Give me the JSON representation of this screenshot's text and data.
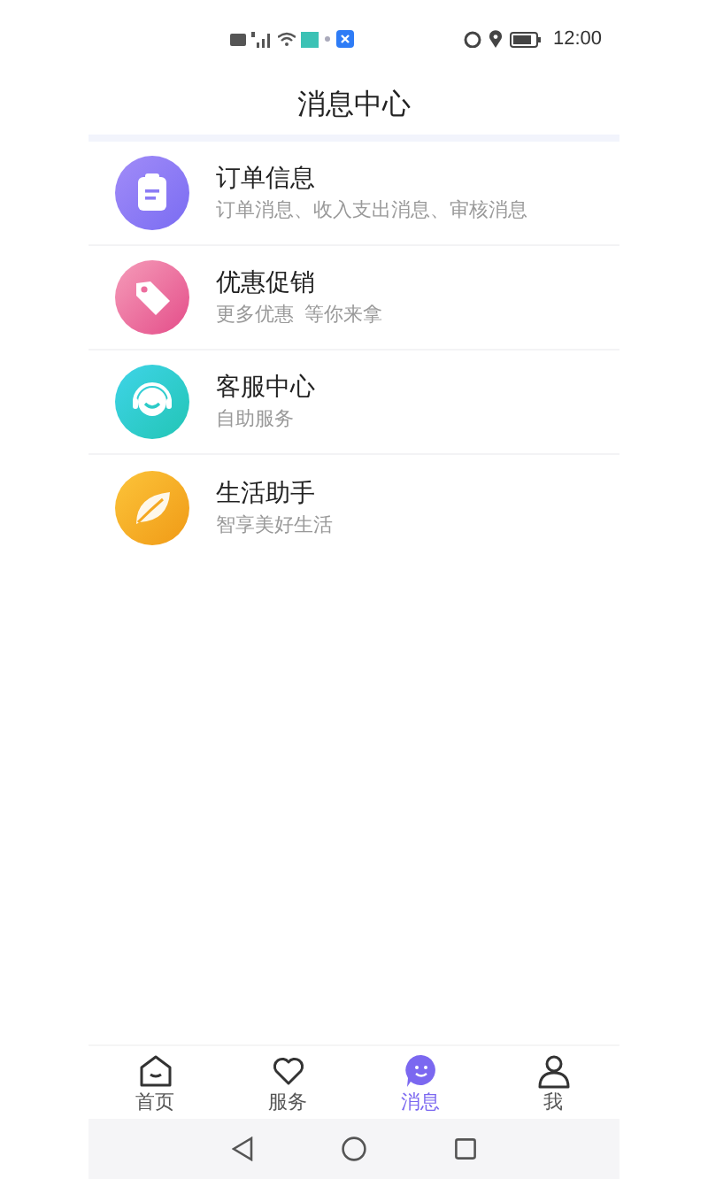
{
  "status_bar": {
    "time": "12:00"
  },
  "header": {
    "title": "消息中心"
  },
  "messages": [
    {
      "kind": "clipboard",
      "title": "订单信息",
      "subtitle": "订单消息、收入支出消息、审核消息"
    },
    {
      "kind": "tag",
      "title": "优惠促销",
      "subtitle": "更多优惠  等你来拿"
    },
    {
      "kind": "headset",
      "title": "客服中心",
      "subtitle": "自助服务"
    },
    {
      "kind": "leaf",
      "title": "生活助手",
      "subtitle": "智享美好生活"
    }
  ],
  "tabs": [
    {
      "kind": "home",
      "label": "首页",
      "selected": false
    },
    {
      "kind": "heart",
      "label": "服务",
      "selected": false
    },
    {
      "kind": "chat",
      "label": "消息",
      "selected": true
    },
    {
      "kind": "person",
      "label": "我",
      "selected": false
    }
  ]
}
